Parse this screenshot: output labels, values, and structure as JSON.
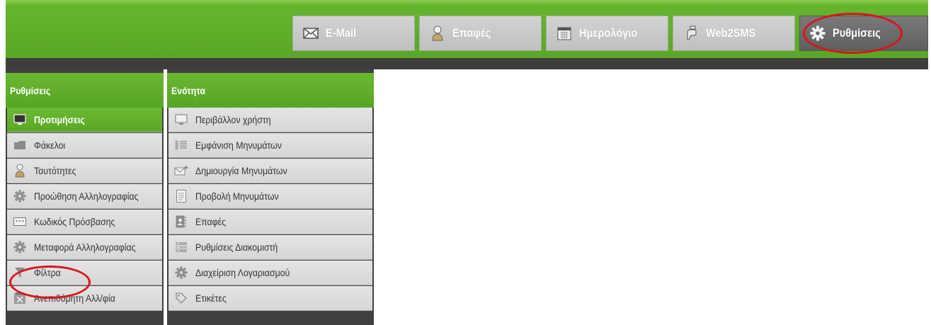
{
  "nav": {
    "tabs": [
      {
        "label": "E-Mail",
        "icon": "envelope-icon"
      },
      {
        "label": "Επαφές",
        "icon": "person-icon"
      },
      {
        "label": "Ημερολόγιο",
        "icon": "calendar-icon"
      },
      {
        "label": "Web2SMS",
        "icon": "mobile-sms-icon"
      },
      {
        "label": "Ρυθμίσεις",
        "icon": "gear-icon",
        "active": true
      }
    ]
  },
  "settings_panel": {
    "title": "Ρυθμίσεις",
    "items": [
      {
        "label": "Προτιμήσεις",
        "icon": "monitor-icon",
        "active": true
      },
      {
        "label": "Φάκελοι",
        "icon": "folder-icon"
      },
      {
        "label": "Ταυτότητες",
        "icon": "person-icon"
      },
      {
        "label": "Προώθηση Αλληλογραφίας",
        "icon": "gear-icon"
      },
      {
        "label": "Κωδικός Πρόσβασης",
        "icon": "password-icon"
      },
      {
        "label": "Μεταφορά Αλληλογραφίας",
        "icon": "gear-icon"
      },
      {
        "label": "Φίλτρα",
        "icon": "filter-icon"
      },
      {
        "label": "Ανεπιθύμητη Αλλ/φία",
        "icon": "spam-icon"
      }
    ]
  },
  "section_panel": {
    "title": "Ενότητα",
    "items": [
      {
        "label": "Περιβάλλον χρήστη",
        "icon": "monitor-icon"
      },
      {
        "label": "Εμφάνιση Μηνυμάτων",
        "icon": "list-icon"
      },
      {
        "label": "Δημιουργία Μηνυμάτων",
        "icon": "compose-icon"
      },
      {
        "label": "Προβολή Μηνυμάτων",
        "icon": "document-icon"
      },
      {
        "label": "Επαφές",
        "icon": "address-book-icon"
      },
      {
        "label": "Ρυθμίσεις Διακομιστή",
        "icon": "server-icon"
      },
      {
        "label": "Διαχείριση Λογαριασμού",
        "icon": "gear-icon"
      },
      {
        "label": "Ετικέτες",
        "icon": "tag-icon"
      }
    ]
  },
  "colors": {
    "accent_green": "#5aa727",
    "annotation_red": "#d9141c"
  }
}
